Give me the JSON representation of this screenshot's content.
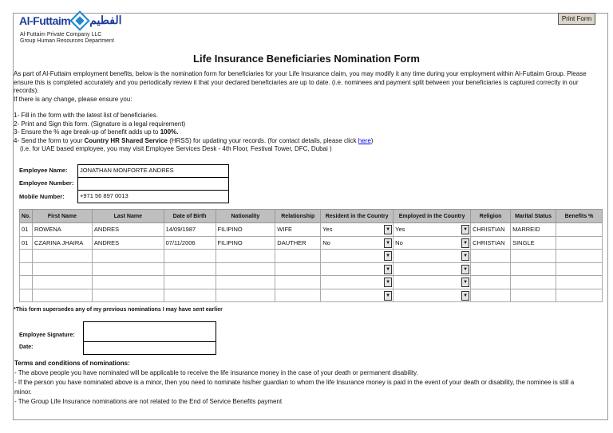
{
  "header": {
    "logo_text": "Al-Futtaim",
    "logo_arabic": "الفطيم",
    "company": "Al-Futtaim Private Company LLC",
    "department": "Group Human Resources Department",
    "print_button": "Print Form"
  },
  "title": "Life Insurance Beneficiaries Nomination Form",
  "intro": {
    "p1": "As part of Al-Futtaim employment benefits, below is the nomination form for beneficiaries for your Life Insurance claim, you may modify it any time during your employment within Al-Futtaim Group. Please ensure this is completed accurately and you periodically review it that your declared beneficiaries are up to date. (i.e. nominees and payment split between your beneficiaries is captured correctly in our records).",
    "p2": "If there is any change, please ensure you:",
    "step1": "1- Fill in the form with the latest list of beneficiaries.",
    "step2": "2- Print and Sign this form. (Signature is a legal requirement)",
    "step3_a": "3- Ensure the % age break-up of benefit adds up to ",
    "step3_b": "100%.",
    "step4_a": "4- Send the form to your ",
    "step4_b": "Country HR Shared Service",
    "step4_c": " (HRSS) for updating your records. (for contact details, please click ",
    "step4_link": "here",
    "step4_d": ")",
    "step4_note": "(i.e. for UAE based employee, you may visit Employee Services Desk  - 4th Floor, Festival Tower, DFC, Dubai )"
  },
  "employee": {
    "name_label": "Employee Name:",
    "name": "JONATHAN MONFORTE ANDRES",
    "number_label": "Employee Number:",
    "number": "",
    "mobile_label": "Mobile Number:",
    "mobile": "+971 56 897 0013"
  },
  "table": {
    "headers": [
      "No.",
      "First Name",
      "Last Name",
      "Date of Birth",
      "Nationality",
      "Relationship",
      "Resident in the Country",
      "Employed in the Country",
      "Religion",
      "Marital Status",
      "Benefits %"
    ],
    "rows": [
      [
        "01",
        "ROWENA",
        "ANDRES",
        "14/09/1987",
        "FILIPINO",
        "WIFE",
        "Yes",
        "Yes",
        "CHRISTIAN",
        "MARREID",
        ""
      ],
      [
        "01",
        "CZARINA JHAIRA",
        "ANDRES",
        "07/11/2006",
        "FILIPINO",
        "DAUTHER",
        "No",
        "No",
        "CHRISTIAN",
        "SINGLE",
        ""
      ],
      [
        "",
        "",
        "",
        "",
        "",
        "",
        "",
        "",
        "",
        "",
        ""
      ],
      [
        "",
        "",
        "",
        "",
        "",
        "",
        "",
        "",
        "",
        "",
        ""
      ],
      [
        "",
        "",
        "",
        "",
        "",
        "",
        "",
        "",
        "",
        "",
        ""
      ],
      [
        "",
        "",
        "",
        "",
        "",
        "",
        "",
        "",
        "",
        "",
        ""
      ]
    ]
  },
  "note": "*This form supersedes any of my previous nominations I may have sent earlier",
  "signature": {
    "sig_label": "Employee Signature:",
    "date_label": "Date:"
  },
  "terms": {
    "title": "Terms and conditions of nominations:",
    "t1": "- The above people you have nominated will be applicable to receive the life insurance money in the case of your death or permanent disability.",
    "t2": "- If the person you have nominated above is a minor, then you need to nominate his/her guardian to whom the life Insurance money is paid in the event of your death or disability, the nominee is still a minor.",
    "t3": "- The Group Life Insurance nominations are not related to the End of Service Benefits payment"
  }
}
